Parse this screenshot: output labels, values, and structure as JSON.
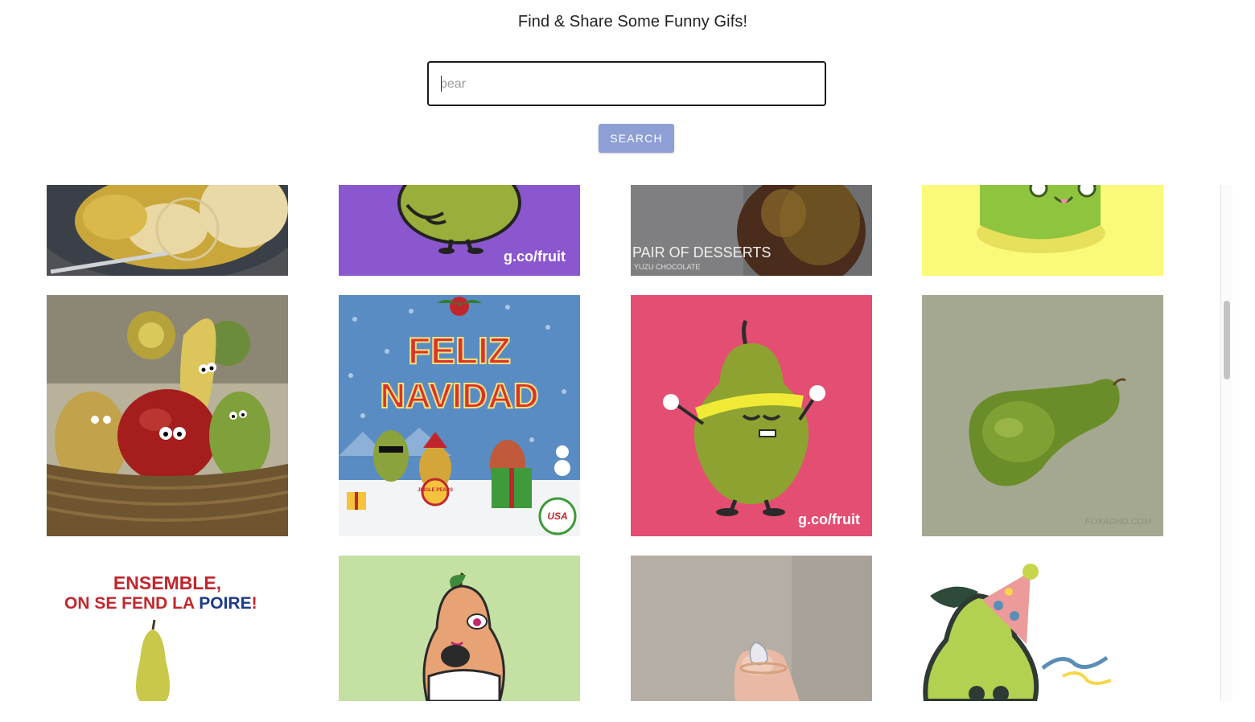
{
  "page": {
    "title": "Find & Share Some Funny Gifs!"
  },
  "search": {
    "placeholder": "pear",
    "value": "",
    "button_label": "SEARCH"
  },
  "gifs": [
    {
      "name": "pear-dessert-cooking-gif",
      "caption": ""
    },
    {
      "name": "dancing-pear-purple-gif",
      "caption": "g.co/fruit"
    },
    {
      "name": "pair-of-desserts-gif",
      "caption": "PAIR OF DESSERTS",
      "sub": "YUZU CHOCOLATE"
    },
    {
      "name": "green-pear-yellow-gif",
      "caption": ""
    },
    {
      "name": "fruit-basket-puppets-gif",
      "caption": ""
    },
    {
      "name": "feliz-navidad-pear-band-gif",
      "line1": "FELIZ",
      "line2": "NAVIDAD",
      "drum": "JINGLE PEARS",
      "badge": "USA"
    },
    {
      "name": "pear-thumbs-up-pink-gif",
      "caption": "g.co/fruit"
    },
    {
      "name": "rotating-green-pear-gif",
      "caption": "FOXADHD.COM"
    },
    {
      "name": "ensemble-poire-gif",
      "line1": "ENSEMBLE,",
      "line2a": "ON SE FEND LA ",
      "line2b": "POIRE",
      "line2c": "!"
    },
    {
      "name": "cartoon-pear-character-gif",
      "caption": ""
    },
    {
      "name": "pear-diamond-ring-gif",
      "caption": ""
    },
    {
      "name": "party-pear-gif",
      "caption": ""
    }
  ]
}
